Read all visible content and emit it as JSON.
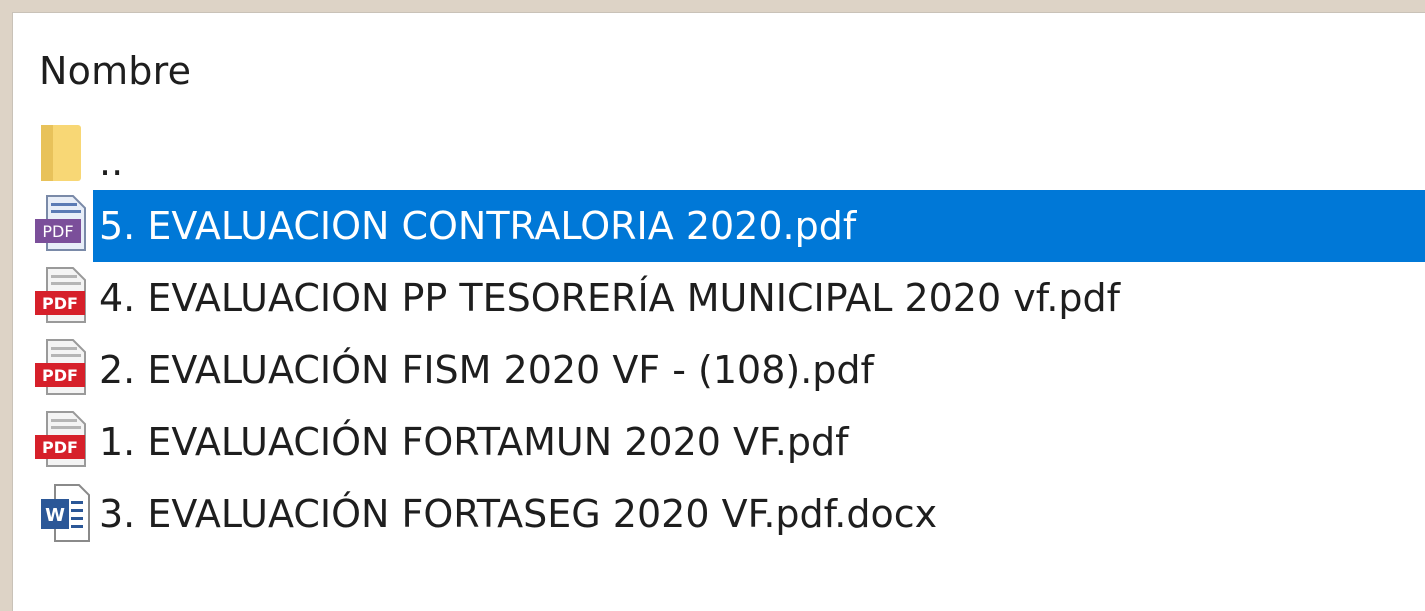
{
  "header": {
    "name_column": "Nombre"
  },
  "files": [
    {
      "label": "..",
      "icon": "folder-icon",
      "selected": false
    },
    {
      "label": "5. EVALUACION CONTRALORIA 2020.pdf",
      "icon": "pdf-purple-icon",
      "selected": true
    },
    {
      "label": "4. EVALUACION PP TESORERÍA MUNICIPAL 2020 vf.pdf",
      "icon": "pdf-red-icon",
      "selected": false
    },
    {
      "label": "2. EVALUACIÓN FISM 2020 VF - (108).pdf",
      "icon": "pdf-red-icon",
      "selected": false
    },
    {
      "label": "1. EVALUACIÓN FORTAMUN 2020 VF.pdf",
      "icon": "pdf-red-icon",
      "selected": false
    },
    {
      "label": "3. EVALUACIÓN FORTASEG 2020 VF.pdf.docx",
      "icon": "word-doc-icon",
      "selected": false
    }
  ],
  "colors": {
    "selection": "#0078d7",
    "pdf_red": "#d6202a",
    "pdf_purple": "#7b4f9a",
    "folder": "#f8d775",
    "word_blue": "#2b5797"
  }
}
